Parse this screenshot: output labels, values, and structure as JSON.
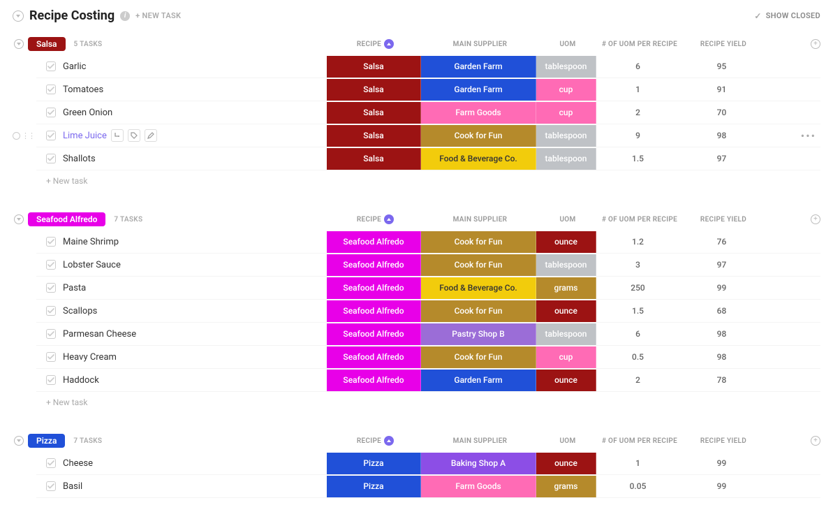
{
  "header": {
    "title": "Recipe Costing",
    "newTask": "+ NEW TASK",
    "showClosed": "SHOW CLOSED"
  },
  "columns": {
    "recipe": "RECIPE",
    "supplier": "MAIN SUPPLIER",
    "uom": "UOM",
    "numUom": "# OF UOM PER RECIPE",
    "yield": "RECIPE YIELD"
  },
  "newTaskRow": "+ New task",
  "groups": [
    {
      "name": "Salsa",
      "pillClass": "bg-salsa",
      "count": "5 TASKS",
      "recipeClass": "bg-salsa",
      "rows": [
        {
          "name": "Garlic",
          "supplier": "Garden Farm",
          "supplierClass": "bg-gardenfarm",
          "uom": "tablespoon",
          "uomClass": "bg-tablespoon",
          "num": "6",
          "yield": "95"
        },
        {
          "name": "Tomatoes",
          "supplier": "Garden Farm",
          "supplierClass": "bg-gardenfarm",
          "uom": "cup",
          "uomClass": "bg-cup",
          "num": "1",
          "yield": "91"
        },
        {
          "name": "Green Onion",
          "supplier": "Farm Goods",
          "supplierClass": "bg-farmgoods",
          "uom": "cup",
          "uomClass": "bg-cup",
          "num": "2",
          "yield": "70"
        },
        {
          "name": "Lime Juice",
          "supplier": "Cook for Fun",
          "supplierClass": "bg-cookforfun",
          "uom": "tablespoon",
          "uomClass": "bg-tablespoon",
          "num": "9",
          "yield": "98",
          "hovered": true
        },
        {
          "name": "Shallots",
          "supplier": "Food & Beverage Co.",
          "supplierClass": "bg-foodbev",
          "uom": "tablespoon",
          "uomClass": "bg-tablespoon",
          "num": "1.5",
          "yield": "97"
        }
      ]
    },
    {
      "name": "Seafood Alfredo",
      "pillClass": "bg-alfredo",
      "count": "7 TASKS",
      "recipeClass": "bg-alfredo",
      "rows": [
        {
          "name": "Maine Shrimp",
          "supplier": "Cook for Fun",
          "supplierClass": "bg-cookforfun",
          "uom": "ounce",
          "uomClass": "bg-ounce",
          "num": "1.2",
          "yield": "76"
        },
        {
          "name": "Lobster Sauce",
          "supplier": "Cook for Fun",
          "supplierClass": "bg-cookforfun",
          "uom": "tablespoon",
          "uomClass": "bg-tablespoon",
          "num": "3",
          "yield": "97"
        },
        {
          "name": "Pasta",
          "supplier": "Food & Beverage Co.",
          "supplierClass": "bg-foodbev",
          "uom": "grams",
          "uomClass": "bg-grams",
          "num": "250",
          "yield": "99"
        },
        {
          "name": "Scallops",
          "supplier": "Cook for Fun",
          "supplierClass": "bg-cookforfun",
          "uom": "ounce",
          "uomClass": "bg-ounce",
          "num": "1.5",
          "yield": "68"
        },
        {
          "name": "Parmesan Cheese",
          "supplier": "Pastry Shop B",
          "supplierClass": "bg-pastryb",
          "uom": "tablespoon",
          "uomClass": "bg-tablespoon",
          "num": "6",
          "yield": "98"
        },
        {
          "name": "Heavy Cream",
          "supplier": "Cook for Fun",
          "supplierClass": "bg-cookforfun",
          "uom": "cup",
          "uomClass": "bg-cup",
          "num": "0.5",
          "yield": "98"
        },
        {
          "name": "Haddock",
          "supplier": "Garden Farm",
          "supplierClass": "bg-gardenfarm",
          "uom": "ounce",
          "uomClass": "bg-ounce",
          "num": "2",
          "yield": "78"
        }
      ]
    },
    {
      "name": "Pizza",
      "pillClass": "bg-pizza",
      "count": "7 TASKS",
      "recipeClass": "bg-pizza",
      "noFooter": true,
      "rows": [
        {
          "name": "Cheese",
          "supplier": "Baking Shop A",
          "supplierClass": "bg-bakinga",
          "uom": "ounce",
          "uomClass": "bg-ounce",
          "num": "1",
          "yield": "99"
        },
        {
          "name": "Basil",
          "supplier": "Farm Goods",
          "supplierClass": "bg-farmgoods",
          "uom": "grams",
          "uomClass": "bg-grams",
          "num": "0.05",
          "yield": "99"
        }
      ]
    }
  ]
}
